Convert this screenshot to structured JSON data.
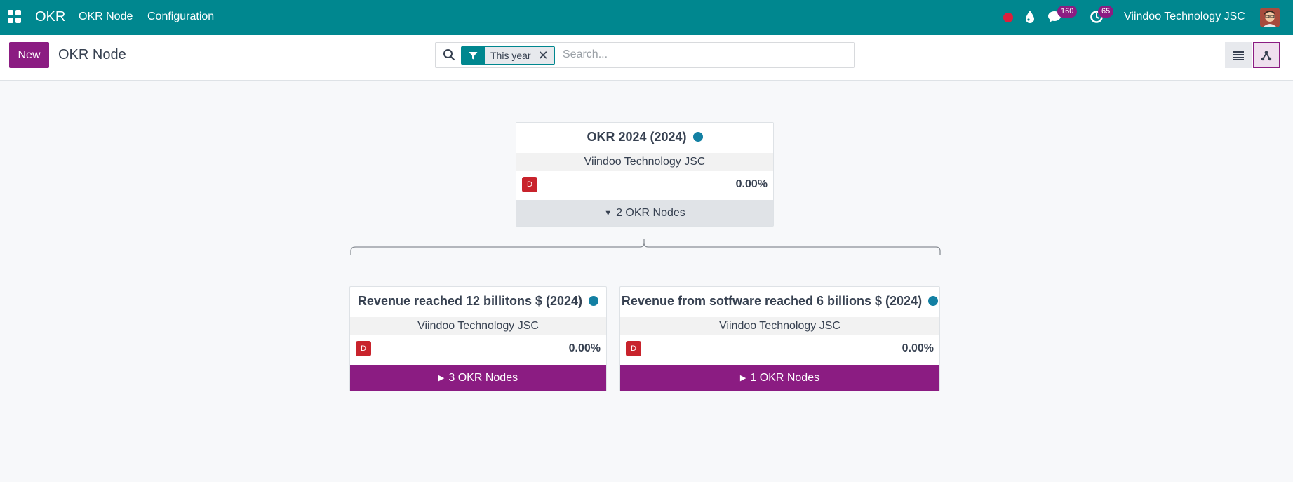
{
  "navbar": {
    "brand": "OKR",
    "menu": [
      "OKR Node",
      "Configuration"
    ],
    "messages_count": "160",
    "activities_count": "65",
    "company": "Viindoo Technology JSC"
  },
  "control": {
    "new_label": "New",
    "title": "OKR Node",
    "facet_label": "This year",
    "search_placeholder": "Search..."
  },
  "org": {
    "root": {
      "title": "OKR 2024 (2024)",
      "company": "Viindoo Technology JSC",
      "badge": "D",
      "progress": "0.00%",
      "expand_label": "2 OKR Nodes"
    },
    "children": [
      {
        "title": "Revenue reached 12 billitons $ (2024)",
        "company": "Viindoo Technology JSC",
        "badge": "D",
        "progress": "0.00%",
        "expand_label": "3 OKR Nodes"
      },
      {
        "title": "Revenue from sotfware reached 6 billions $ (2024)",
        "company": "Viindoo Technology JSC",
        "badge": "D",
        "progress": "0.00%",
        "expand_label": "1 OKR Nodes"
      }
    ]
  },
  "colors": {
    "navbar": "#00878f",
    "primary": "#8b1c82",
    "state_dot": "#1380a3",
    "danger_badge": "#c8232c"
  }
}
